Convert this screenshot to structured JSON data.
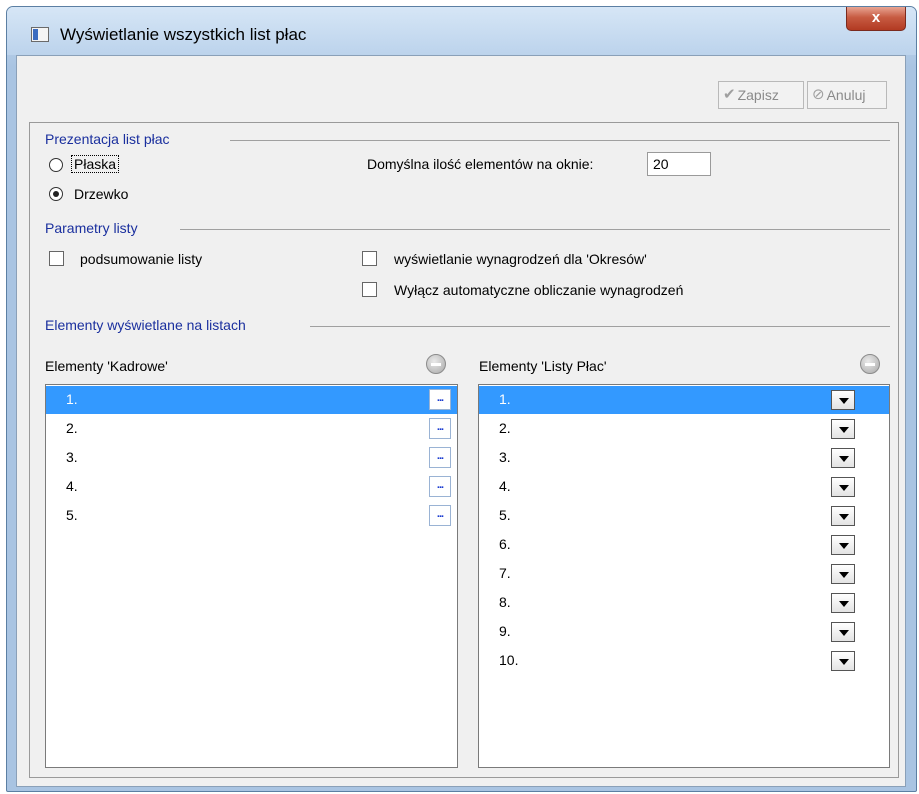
{
  "window": {
    "title": "Wyświetlanie wszystkich list płac",
    "close_label": "x"
  },
  "toolbar": {
    "save_label": "Zapisz",
    "cancel_label": "Anuluj"
  },
  "presentation": {
    "group_label": "Prezentacja list płac",
    "options": [
      {
        "label": "Płaska",
        "checked": false
      },
      {
        "label": "Drzewko",
        "checked": true
      }
    ],
    "default_count_label": "Domyślna ilość elementów na oknie:",
    "default_count_value": "20"
  },
  "list_params": {
    "group_label": "Parametry listy",
    "checkboxes": [
      {
        "label": "podsumowanie listy",
        "checked": false
      },
      {
        "label": "wyświetlanie wynagrodzeń dla 'Okresów'",
        "checked": false
      },
      {
        "label": "Wyłącz automatyczne obliczanie wynagrodzeń",
        "checked": false
      }
    ]
  },
  "elements": {
    "group_label": "Elementy wyświetlane na listach",
    "kadrowe": {
      "label": "Elementy 'Kadrowe'",
      "rows": [
        "1.",
        "2.",
        "3.",
        "4.",
        "5."
      ],
      "selected_index": 0,
      "button_label": "..."
    },
    "listy_plac": {
      "label": "Elementy 'Listy Płac'",
      "rows": [
        "1.",
        "2.",
        "3.",
        "4.",
        "5.",
        "6.",
        "7.",
        "8.",
        "9.",
        "10."
      ],
      "selected_index": 0
    }
  }
}
